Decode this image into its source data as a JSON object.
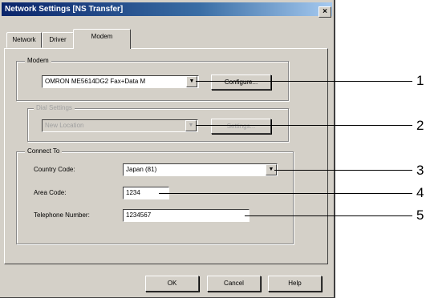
{
  "dialog": {
    "title": "Network Settings [NS Transfer]",
    "close_glyph": "×"
  },
  "tabs": [
    {
      "label": "Network"
    },
    {
      "label": "Driver"
    },
    {
      "label": "Modem",
      "selected": true
    }
  ],
  "modem_group": {
    "label": "Modem",
    "selected_modem": "OMRON ME5614DG2 Fax+Data M",
    "configure_label": "Configure..."
  },
  "location_group": {
    "label": "Dial Settings",
    "location_value": "New Location",
    "button_label": "Settings..."
  },
  "connect_group": {
    "label": "Connect To",
    "country_code_label": "Country Code:",
    "country_code_value": "Japan (81)",
    "area_code_label": "Area Code:",
    "area_code_value": "1234",
    "telephone_label": "Telephone Number:",
    "telephone_value": "1234567"
  },
  "footer": {
    "ok_label": "OK",
    "cancel_label": "Cancel",
    "help_label": "Help"
  },
  "callouts": [
    "1",
    "2",
    "3",
    "4",
    "5"
  ],
  "icons": {
    "dropdown": "▼"
  }
}
